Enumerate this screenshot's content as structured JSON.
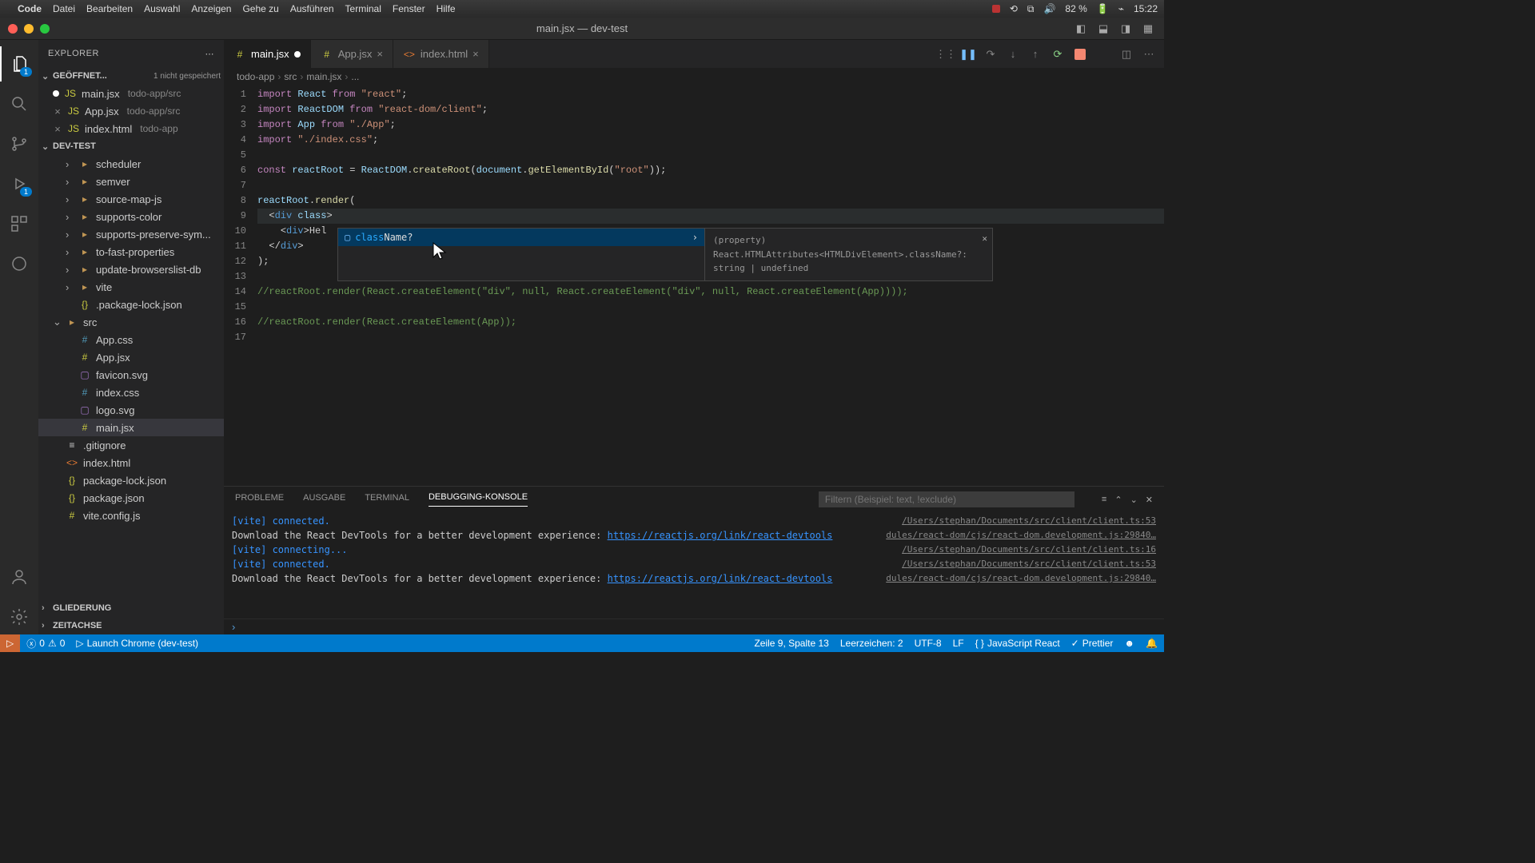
{
  "menubar": {
    "app": "Code",
    "items": [
      "Datei",
      "Bearbeiten",
      "Auswahl",
      "Anzeigen",
      "Gehe zu",
      "Ausführen",
      "Terminal",
      "Fenster",
      "Hilfe"
    ],
    "battery": "82 %",
    "time": "15:22"
  },
  "window": {
    "title": "main.jsx — dev-test"
  },
  "sidebar": {
    "title": "EXPLORER",
    "open_editors_label": "GEÖFFNET...",
    "unsaved_hint": "1 nicht gespeichert",
    "open_editors": [
      {
        "name": "main.jsx",
        "hint": "todo-app/src",
        "dirty": true
      },
      {
        "name": "App.jsx",
        "hint": "todo-app/src",
        "dirty": false
      },
      {
        "name": "index.html",
        "hint": "todo-app",
        "dirty": false
      }
    ],
    "project": "DEV-TEST",
    "tree": [
      {
        "depth": 2,
        "icon": "folder",
        "chev": "›",
        "label": "scheduler"
      },
      {
        "depth": 2,
        "icon": "folder",
        "chev": "›",
        "label": "semver"
      },
      {
        "depth": 2,
        "icon": "folder",
        "chev": "›",
        "label": "source-map-js"
      },
      {
        "depth": 2,
        "icon": "folder",
        "chev": "›",
        "label": "supports-color"
      },
      {
        "depth": 2,
        "icon": "folder",
        "chev": "›",
        "label": "supports-preserve-sym..."
      },
      {
        "depth": 2,
        "icon": "folder",
        "chev": "›",
        "label": "to-fast-properties"
      },
      {
        "depth": 2,
        "icon": "folder",
        "chev": "›",
        "label": "update-browserslist-db"
      },
      {
        "depth": 2,
        "icon": "folder",
        "chev": "›",
        "label": "vite"
      },
      {
        "depth": 2,
        "icon": "json",
        "chev": "",
        "label": ".package-lock.json"
      },
      {
        "depth": 1,
        "icon": "folder",
        "chev": "⌄",
        "label": "src"
      },
      {
        "depth": 2,
        "icon": "css",
        "chev": "",
        "label": "App.css"
      },
      {
        "depth": 2,
        "icon": "js",
        "chev": "",
        "label": "App.jsx"
      },
      {
        "depth": 2,
        "icon": "svg",
        "chev": "",
        "label": "favicon.svg"
      },
      {
        "depth": 2,
        "icon": "css",
        "chev": "",
        "label": "index.css"
      },
      {
        "depth": 2,
        "icon": "svg",
        "chev": "",
        "label": "logo.svg"
      },
      {
        "depth": 2,
        "icon": "js",
        "chev": "",
        "label": "main.jsx",
        "sel": true
      },
      {
        "depth": 1,
        "icon": "file",
        "chev": "",
        "label": ".gitignore"
      },
      {
        "depth": 1,
        "icon": "html",
        "chev": "",
        "label": "index.html"
      },
      {
        "depth": 1,
        "icon": "json",
        "chev": "",
        "label": "package-lock.json"
      },
      {
        "depth": 1,
        "icon": "json",
        "chev": "",
        "label": "package.json"
      },
      {
        "depth": 1,
        "icon": "js",
        "chev": "",
        "label": "vite.config.js"
      }
    ],
    "outline": "GLIEDERUNG",
    "timeline": "ZEITACHSE"
  },
  "tabs": [
    {
      "name": "main.jsx",
      "icon": "js",
      "active": true,
      "dirty": true
    },
    {
      "name": "App.jsx",
      "icon": "js",
      "active": false,
      "dirty": false
    },
    {
      "name": "index.html",
      "icon": "html",
      "active": false,
      "dirty": false
    }
  ],
  "breadcrumbs": [
    "todo-app",
    "src",
    "main.jsx",
    "..."
  ],
  "code": {
    "lines": 17,
    "intellisense": {
      "match_pre": "class",
      "match_post": "Name?",
      "doc": "(property) React.HTMLAttributes<HTMLDivElement>.className?: string | undefined"
    }
  },
  "panel": {
    "tabs": [
      "PROBLEME",
      "AUSGABE",
      "TERMINAL",
      "DEBUGGING-KONSOLE"
    ],
    "active": 3,
    "filter_placeholder": "Filtern (Beispiel: text, !exclude)",
    "console": [
      {
        "t": "[vite] connected.",
        "cls": "vite",
        "src": "Users/stephan/Documents/src/client/client.ts:53/"
      },
      {
        "t": "Download the React DevTools for a better development experience: https://reactjs.org/link/react-devtools",
        "cls": "",
        "src": "…dules/react-dom/cjs/react-dom.development.js:29840"
      },
      {
        "t": "[vite] connecting...",
        "cls": "vite",
        "src": "Users/stephan/Documents/src/client/client.ts:16/"
      },
      {
        "t": "[vite] connected.",
        "cls": "vite",
        "src": "Users/stephan/Documents/src/client/client.ts:53/"
      },
      {
        "t": "Download the React DevTools for a better development experience: https://reactjs.org/link/react-devtools",
        "cls": "",
        "src": "…dules/react-dom/cjs/react-dom.development.js:29840"
      }
    ]
  },
  "status": {
    "debug_badge": "",
    "errors": "0",
    "warnings": "0",
    "launch": "Launch Chrome (dev-test)",
    "pos": "Zeile 9, Spalte 13",
    "indent": "Leerzeichen: 2",
    "enc": "UTF-8",
    "eol": "LF",
    "lang": "JavaScript React",
    "prettier": "Prettier"
  }
}
